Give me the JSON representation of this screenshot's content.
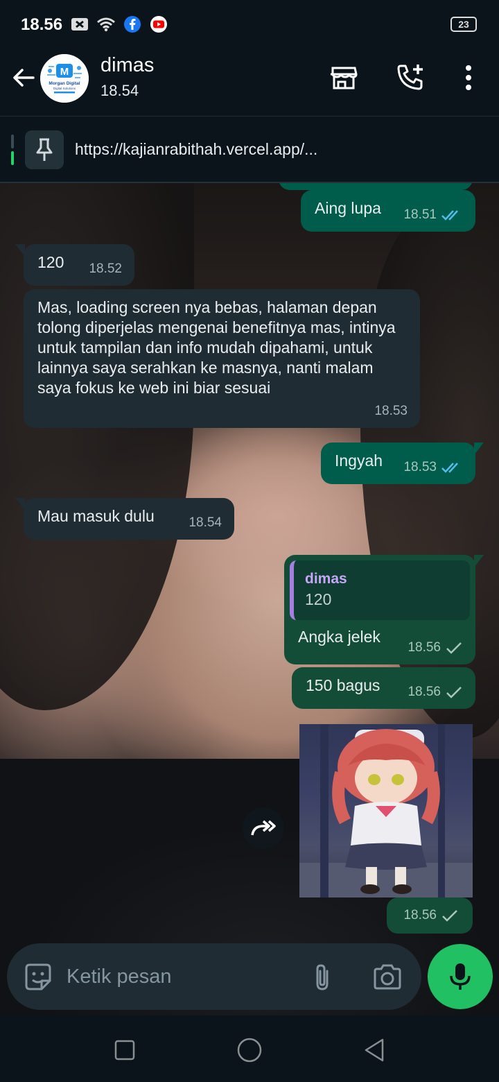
{
  "status_bar": {
    "time": "18.56",
    "battery": "23"
  },
  "header": {
    "contact_name": "dimas",
    "last_seen": "18.54",
    "avatar_text": "Morgan Digital",
    "avatar_sub": "Digital Solutions"
  },
  "pinned": {
    "url": "https://kajianrabithah.vercel.app/..."
  },
  "messages": [
    {
      "text": "Aing lupa",
      "time": "18.51"
    },
    {
      "text": "120",
      "time": "18.52"
    },
    {
      "text": "Mas, loading screen nya bebas, halaman depan tolong diperjelas mengenai benefitnya mas, intinya untuk tampilan dan info mudah dipahami, untuk lainnya saya serahkan ke masnya, nanti malam saya fokus ke web ini biar sesuai",
      "time": "18.53"
    },
    {
      "text": "Ingyah",
      "time": "18.53"
    },
    {
      "text": "Mau masuk dulu",
      "time": "18.54"
    },
    {
      "quote_name": "dimas",
      "quote_text": "120",
      "text": "Angka jelek",
      "time": "18.56"
    },
    {
      "text": "150 bagus",
      "time": "18.56"
    },
    {
      "time": "18.56"
    }
  ],
  "input": {
    "placeholder": "Ketik pesan"
  },
  "colors": {
    "incoming": "#202c33",
    "outgoing": "#005c4b",
    "accent": "#21c063",
    "quote_bar": "#a57ee0"
  }
}
